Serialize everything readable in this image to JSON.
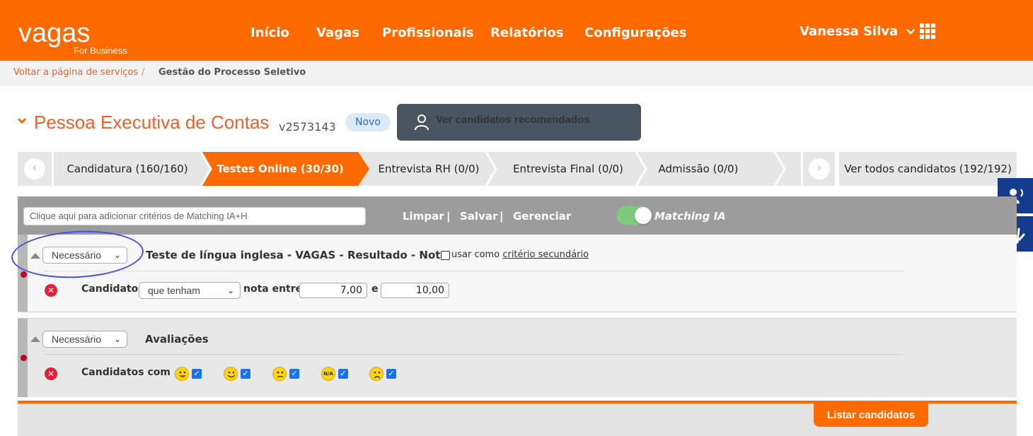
{
  "header": {
    "logo": "vagas",
    "logo_sub": "For Business",
    "nav": [
      "Início",
      "Vagas",
      "Profissionais",
      "Relatórios",
      "Configurações"
    ],
    "user_name": "Vanessa Silva",
    "apps_icon": "grid-icon",
    "brand_color": "#ff6a00"
  },
  "breadcrumb": {
    "back": "Voltar a página de serviços",
    "separator": "/",
    "current": "Gestão do Processo Seletivo"
  },
  "job": {
    "title": "Pessoa Executiva de Contas",
    "code": "v2573143",
    "badge": "Novo",
    "recommended_button": "Ver candidatos recomendados"
  },
  "steps": [
    {
      "label": "Candidatura (160/160)",
      "active": false
    },
    {
      "label": "Testes Online (30/30)",
      "active": true
    },
    {
      "label": "Entrevista RH (0/0)",
      "active": false
    },
    {
      "label": "Entrevista Final (0/0)",
      "active": false
    },
    {
      "label": "Admissão (0/0)",
      "active": false
    }
  ],
  "all_candidates": "Ver todos candidatos (192/192)",
  "criteria": {
    "placeholder": "Clique aqui para adicionar critérios de Matching IA+H",
    "clear": "Limpar",
    "save": "Salvar",
    "manage": "Gerenciar",
    "divider": "|",
    "matching_label": "Matching IA",
    "matching_on": true
  },
  "criterion1": {
    "requirement": "Necessário",
    "title": "Teste de língua inglesa - VAGAS - Resultado - Nota",
    "secondary_prefix": "usar como",
    "secondary_link": "critério secundário",
    "candidates_label": "Candidatos",
    "condition": "que tenham",
    "range_label": "nota entre",
    "min": "7,00",
    "and_label": "e",
    "max": "10,00"
  },
  "criterion2": {
    "requirement": "Necessário",
    "title": "Avaliações",
    "candidates_label": "Candidatos com",
    "faces": [
      "very-happy-face-icon",
      "happy-face-icon",
      "neutral-face-icon",
      "na-face-icon",
      "sad-face-icon"
    ],
    "na_text": "N/A"
  },
  "list_button": "Listar candidatos"
}
